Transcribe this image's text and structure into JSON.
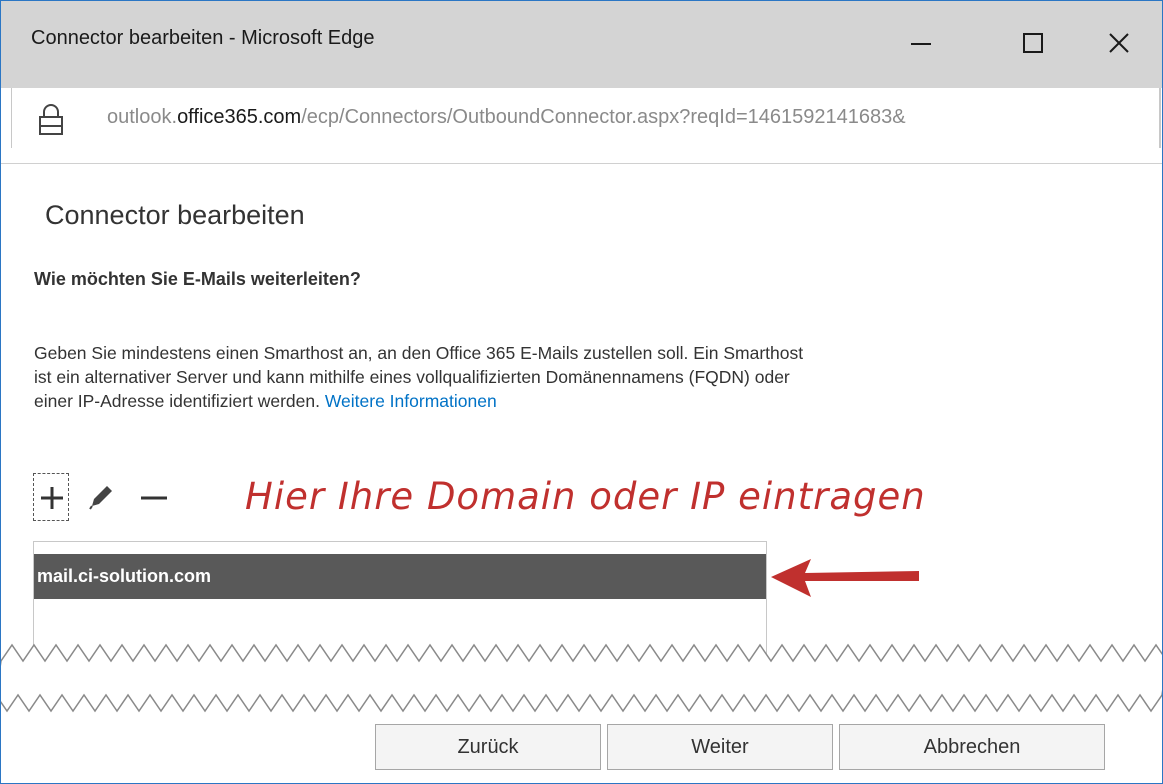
{
  "window": {
    "title": "Connector bearbeiten - Microsoft Edge",
    "controls": [
      "minimize",
      "maximize",
      "close"
    ]
  },
  "address_bar": {
    "scheme_part": "outlook.",
    "host": "office365.com",
    "path": "/ecp/Connectors/OutboundConnector.aspx?reqId=1461592141683&",
    "icon": "lock-icon"
  },
  "page": {
    "title": "Connector bearbeiten",
    "question": "Wie möchten Sie E-Mails weiterleiten?",
    "description": "Geben Sie mindestens einen Smarthost an, an den Office 365 E-Mails zustellen soll. Ein Smarthost ist ein alternativer Server und kann mithilfe eines vollqualifizierten Domänennamens (FQDN) oder einer IP-Adresse identifiziert werden.",
    "more_info_link": "Weitere Informationen"
  },
  "toolbar": {
    "icons": [
      "add-icon",
      "edit-icon",
      "remove-icon"
    ]
  },
  "annotation": {
    "text": "Hier Ihre Domain oder IP eintragen",
    "color": "#c0302e"
  },
  "smarthosts": [
    {
      "name": "mail.ci-solution.com",
      "selected": true
    }
  ],
  "footer": {
    "back_label": "Zurück",
    "next_label": "Weiter",
    "cancel_label": "Abbrechen"
  },
  "colors": {
    "titlebar": "#d4d4d4",
    "link": "#0072c6",
    "selected_row": "#595959",
    "window_border": "#2b76c4"
  }
}
